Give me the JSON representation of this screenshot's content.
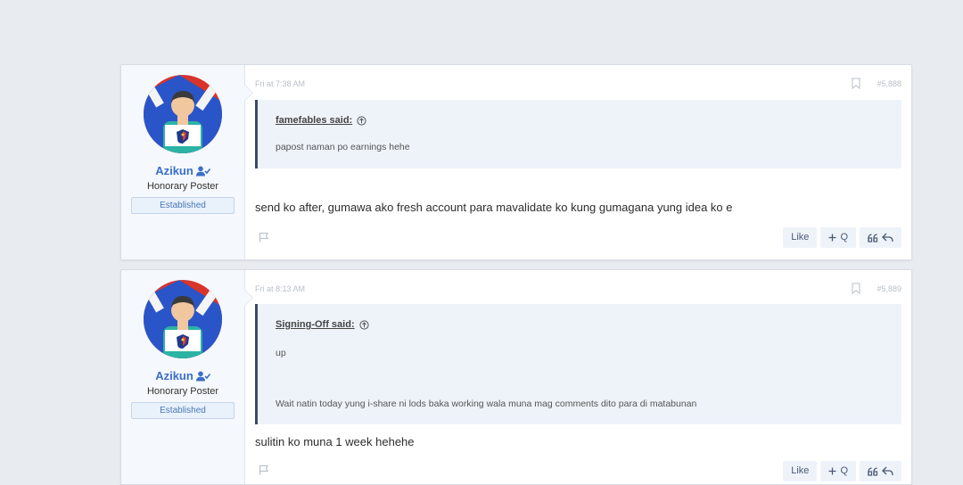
{
  "posts": [
    {
      "date": "Fri at 7:38 AM",
      "number": "#5,888",
      "user": {
        "name": "Azikun",
        "title": "Honorary Poster",
        "badge": "Established"
      },
      "quote": {
        "author": "famefables said:",
        "lines": [
          "papost naman po earnings hehe"
        ]
      },
      "message": "send ko after, gumawa ako fresh account para mavalidate ko kung gumagana yung idea ko e",
      "actions": {
        "like": "Like",
        "quote": "Q"
      }
    },
    {
      "date": "Fri at 8:13 AM",
      "number": "#5,889",
      "user": {
        "name": "Azikun",
        "title": "Honorary Poster",
        "badge": "Established"
      },
      "quote": {
        "author": "Signing-Off said:",
        "lines": [
          "up",
          "Wait natin today yung i-share ni lods baka working wala muna mag comments dito para di matabunan"
        ]
      },
      "message": "sulitin ko muna 1 week hehehe",
      "actions": {
        "like": "Like",
        "quote": "Q"
      }
    }
  ],
  "icons": {
    "verified": "user-check-icon",
    "bookmark": "bookmark-icon",
    "report": "flag-icon",
    "expand_quote": "arrow-up-circle-icon",
    "multiquote": "plus-icon",
    "reply_quote": "quote-marks-icon",
    "reply": "reply-arrow-icon"
  },
  "colors": {
    "username": "#3a6fc9",
    "quote_border": "#3b4b66",
    "quote_bg": "#eef3fa",
    "page_bg": "#e8ebf0"
  }
}
